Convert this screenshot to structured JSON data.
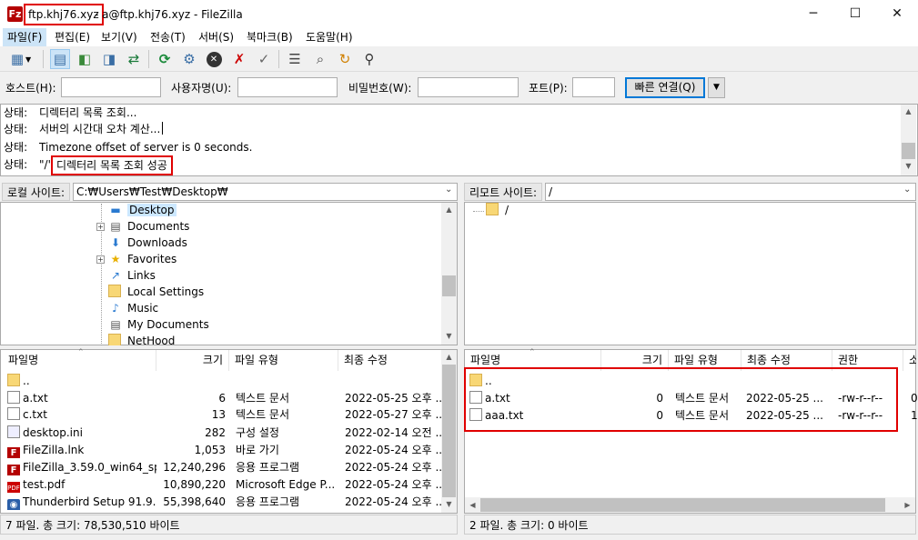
{
  "window": {
    "host": "ftp.khj76.xyz",
    "rest": "- a@ftp.khj76.xyz - FileZilla",
    "minimize": "─",
    "maximize": "☐",
    "close": "✕"
  },
  "menu": [
    "파일(F)",
    "편집(E)",
    "보기(V)",
    "전송(T)",
    "서버(S)",
    "북마크(B)",
    "도움말(H)"
  ],
  "quickconnect": {
    "host_label": "호스트(H):",
    "user_label": "사용자명(U):",
    "pass_label": "비밀번호(W):",
    "port_label": "포트(P):",
    "button": "빠른 연결(Q)",
    "host": "",
    "user": "",
    "pass": "",
    "port": ""
  },
  "log": [
    {
      "label": "상태:",
      "text": "디렉터리 목록 조회..."
    },
    {
      "label": "상태:",
      "text": "서버의 시간대 오차 계산..."
    },
    {
      "label": "상태:",
      "text": "Timezone offset of server is 0 seconds."
    },
    {
      "label": "상태:",
      "prefix": "\"/\"",
      "text": "디렉터리 목록 조회 성공"
    }
  ],
  "local": {
    "site_label": "로컬 사이트:",
    "path": "C:₩Users₩Test₩Desktop₩",
    "tree": [
      {
        "name": "Desktop",
        "icon": "desktop-icon",
        "selected": true,
        "expander": false
      },
      {
        "name": "Documents",
        "icon": "documents-icon",
        "expander": true
      },
      {
        "name": "Downloads",
        "icon": "downloads-icon",
        "expander": false
      },
      {
        "name": "Favorites",
        "icon": "favorites-icon",
        "expander": true
      },
      {
        "name": "Links",
        "icon": "links-icon",
        "expander": false
      },
      {
        "name": "Local Settings",
        "icon": "folder-icon",
        "expander": false
      },
      {
        "name": "Music",
        "icon": "music-icon",
        "expander": false
      },
      {
        "name": "My Documents",
        "icon": "documents-icon",
        "expander": false
      },
      {
        "name": "NetHood",
        "icon": "folder-icon",
        "expander": false
      }
    ],
    "columns": [
      "파일명",
      "크기",
      "파일 유형",
      "최종 수정"
    ],
    "files": [
      {
        "name": "..",
        "size": "",
        "type": "",
        "modified": "",
        "icon": "folder"
      },
      {
        "name": "a.txt",
        "size": "6",
        "type": "텍스트 문서",
        "modified": "2022-05-25 오후 ...",
        "icon": "txt"
      },
      {
        "name": "c.txt",
        "size": "13",
        "type": "텍스트 문서",
        "modified": "2022-05-27 오후 ...",
        "icon": "txt"
      },
      {
        "name": "desktop.ini",
        "size": "282",
        "type": "구성 설정",
        "modified": "2022-02-14 오전 ...",
        "icon": "ini"
      },
      {
        "name": "FileZilla.lnk",
        "size": "1,053",
        "type": "바로 가기",
        "modified": "2022-05-24 오후 ...",
        "icon": "exe"
      },
      {
        "name": "FileZilla_3.59.0_win64_sp...",
        "size": "12,240,296",
        "type": "응용 프로그램",
        "modified": "2022-05-24 오후 ...",
        "icon": "exe"
      },
      {
        "name": "test.pdf",
        "size": "10,890,220",
        "type": "Microsoft Edge P...",
        "modified": "2022-05-24 오후 ...",
        "icon": "pdf"
      },
      {
        "name": "Thunderbird Setup 91.9....",
        "size": "55,398,640",
        "type": "응용 프로그램",
        "modified": "2022-05-24 오후 ...",
        "icon": "tbird"
      }
    ],
    "status": "7 파일. 총 크기: 78,530,510 바이트"
  },
  "remote": {
    "site_label": "리모트 사이트:",
    "path": "/",
    "tree": [
      {
        "name": "/"
      }
    ],
    "columns": [
      "파일명",
      "크기",
      "파일 유형",
      "최종 수정",
      "권한",
      "소"
    ],
    "files": [
      {
        "name": "..",
        "size": "",
        "type": "",
        "modified": "",
        "perm": "",
        "owner": "",
        "icon": "folder"
      },
      {
        "name": "a.txt",
        "size": "0",
        "type": "텍스트 문서",
        "modified": "2022-05-25 ...",
        "perm": "-rw-r--r--",
        "owner": "0",
        "icon": "txt"
      },
      {
        "name": "aaa.txt",
        "size": "0",
        "type": "텍스트 문서",
        "modified": "2022-05-25 ...",
        "perm": "-rw-r--r--",
        "owner": "1",
        "icon": "txt"
      }
    ],
    "status": "2 파일. 총 크기: 0 바이트"
  }
}
